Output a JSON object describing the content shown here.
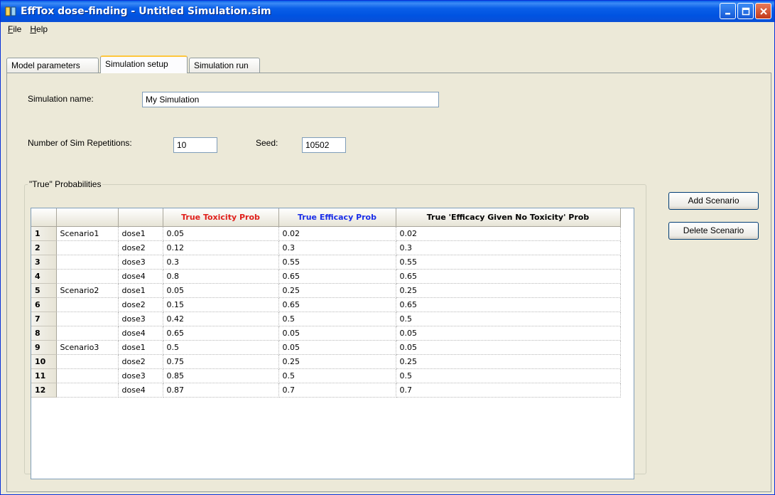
{
  "window": {
    "title": "EffTox dose-finding - Untitled Simulation.sim",
    "icon": "efftox-app-icon",
    "title_buttons": [
      "minimize-icon",
      "maximize-icon",
      "close-icon"
    ]
  },
  "menu": [
    {
      "label": "File",
      "mnemonic": "F"
    },
    {
      "label": "Help",
      "mnemonic": "H"
    }
  ],
  "tabs": [
    {
      "label": "Model parameters",
      "active": false
    },
    {
      "label": "Simulation setup",
      "active": true
    },
    {
      "label": "Simulation run",
      "active": false
    }
  ],
  "form": {
    "sim_name_label": "Simulation name:",
    "sim_name_value": "My Simulation",
    "reps_label": "Number of Sim Repetitions:",
    "reps_value": "10",
    "seed_label": "Seed:",
    "seed_value": "10502"
  },
  "group_label": "\"True\" Probabilities",
  "grid": {
    "headers": [
      "",
      "",
      "",
      "True Toxicity Prob",
      "True Efficacy Prob",
      "True 'Efficacy Given No Toxicity' Prob"
    ],
    "header_colors": {
      "toxicity": "#e0201c",
      "efficacy": "#1a2ee8",
      "efficacy_no_tox": "#000000"
    },
    "rows": [
      [
        "1",
        "Scenario1",
        "dose1",
        "0.05",
        "0.02",
        "0.02"
      ],
      [
        "2",
        "",
        "dose2",
        "0.12",
        "0.3",
        "0.3"
      ],
      [
        "3",
        "",
        "dose3",
        "0.3",
        "0.55",
        "0.55"
      ],
      [
        "4",
        "",
        "dose4",
        "0.8",
        "0.65",
        "0.65"
      ],
      [
        "5",
        "Scenario2",
        "dose1",
        "0.05",
        "0.25",
        "0.25"
      ],
      [
        "6",
        "",
        "dose2",
        "0.15",
        "0.65",
        "0.65"
      ],
      [
        "7",
        "",
        "dose3",
        "0.42",
        "0.5",
        "0.5"
      ],
      [
        "8",
        "",
        "dose4",
        "0.65",
        "0.05",
        "0.05"
      ],
      [
        "9",
        "Scenario3",
        "dose1",
        "0.5",
        "0.05",
        "0.05"
      ],
      [
        "10",
        "",
        "dose2",
        "0.75",
        "0.25",
        "0.25"
      ],
      [
        "11",
        "",
        "dose3",
        "0.85",
        "0.5",
        "0.5"
      ],
      [
        "12",
        "",
        "dose4",
        "0.87",
        "0.7",
        "0.7"
      ]
    ]
  },
  "buttons": {
    "add_scenario": "Add Scenario",
    "delete_scenario": "Delete Scenario"
  }
}
